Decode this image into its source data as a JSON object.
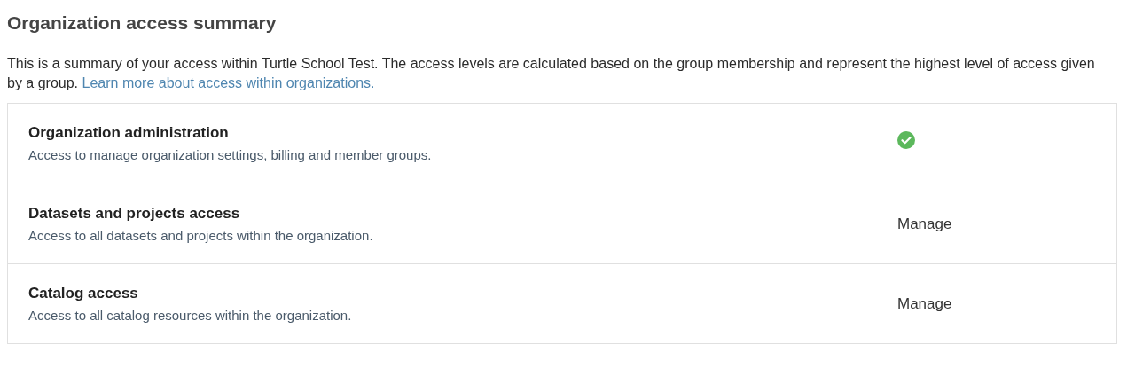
{
  "title": "Organization access summary",
  "intro": {
    "text": "This is a summary of your access within Turtle School Test. The access levels are calculated based on the group membership and represent the highest level of access given by a group.",
    "link": "Learn more about access within organizations."
  },
  "rows": [
    {
      "title": "Organization administration",
      "description": "Access to manage organization settings, billing and member groups.",
      "access": {
        "kind": "check"
      }
    },
    {
      "title": "Datasets and projects access",
      "description": "Access to all datasets and projects within the organization.",
      "access": {
        "kind": "text",
        "label": "Manage"
      }
    },
    {
      "title": "Catalog access",
      "description": "Access to all catalog resources within the organization.",
      "access": {
        "kind": "text",
        "label": "Manage"
      }
    }
  ]
}
